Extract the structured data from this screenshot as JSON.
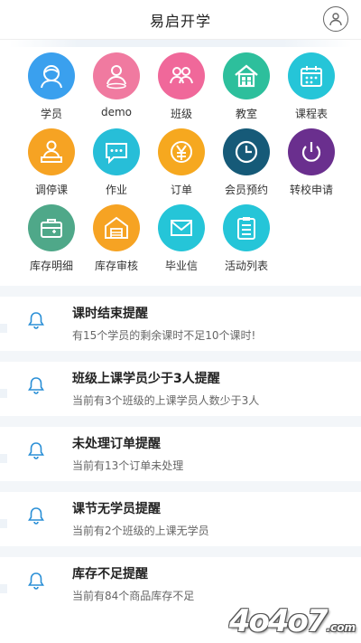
{
  "header": {
    "title": "易启开学",
    "profile_icon": "user-circle-icon"
  },
  "menu": [
    {
      "label": "学员",
      "icon": "student-icon",
      "color": "#3aa0ee"
    },
    {
      "label": "demo",
      "icon": "location-user-icon",
      "color": "#f07aa0"
    },
    {
      "label": "班级",
      "icon": "group-icon",
      "color": "#f0689a"
    },
    {
      "label": "教室",
      "icon": "house-icon",
      "color": "#2dbf9c"
    },
    {
      "label": "课程表",
      "icon": "calendar-icon",
      "color": "#25c5d8"
    },
    {
      "label": "调停课",
      "icon": "person-podium-icon",
      "color": "#f6a323"
    },
    {
      "label": "作业",
      "icon": "chat-icon",
      "color": "#27bed8"
    },
    {
      "label": "订单",
      "icon": "yen-icon",
      "color": "#f6a81f"
    },
    {
      "label": "会员预约",
      "icon": "clock-icon",
      "color": "#165a78"
    },
    {
      "label": "转校申请",
      "icon": "power-icon",
      "color": "#6a2f8e"
    },
    {
      "label": "库存明细",
      "icon": "briefcase-icon",
      "color": "#4fa889"
    },
    {
      "label": "库存审核",
      "icon": "warehouse-icon",
      "color": "#f6a323"
    },
    {
      "label": "毕业信",
      "icon": "envelope-icon",
      "color": "#25c5d8"
    },
    {
      "label": "活动列表",
      "icon": "clipboard-list-icon",
      "color": "#25c5d8"
    }
  ],
  "reminders": [
    {
      "title": "课时结束提醒",
      "desc": "有15个学员的剩余课时不足10个课时!"
    },
    {
      "title": "班级上课学员少于3人提醒",
      "desc": "当前有3个班级的上课学员人数少于3人"
    },
    {
      "title": "未处理订单提醒",
      "desc": "当前有13个订单未处理"
    },
    {
      "title": "课节无学员提醒",
      "desc": "当前有2个班级的上课无学员"
    },
    {
      "title": "库存不足提醒",
      "desc": "当前有84个商品库存不足"
    }
  ],
  "watermark": {
    "text": "4o4o7",
    "suffix": ".com"
  },
  "colors": {
    "bell": "#2a8fd6",
    "divider": "#f3f6f9"
  }
}
